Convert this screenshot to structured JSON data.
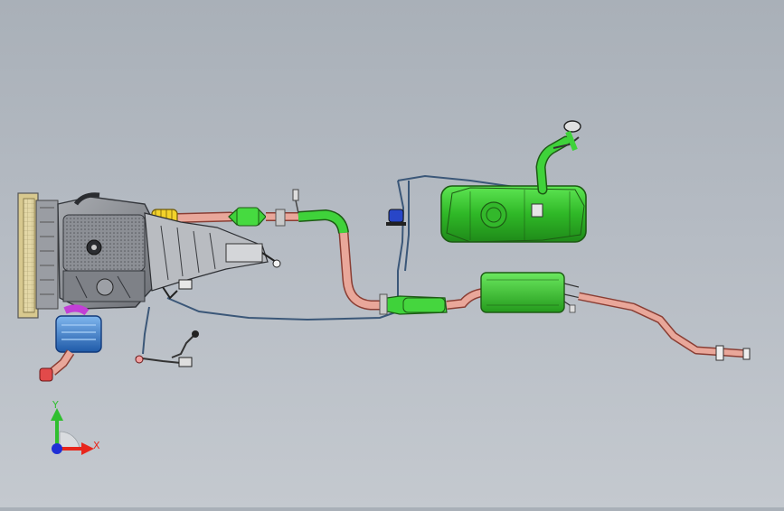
{
  "viewport": {
    "background_top": "#a9b0b8",
    "background_bottom": "#c4c9cf"
  },
  "triad": {
    "x_label": "X",
    "y_label": "Y",
    "x_color": "#e8261c",
    "y_color": "#2fbf2f",
    "z_color": "#1f2fd6"
  },
  "colors": {
    "exhaust_pipe": "#e9a79a",
    "exhaust_outline": "#8a3e34",
    "green_part": "#3fd23a",
    "green_outline": "#1d5a14",
    "fuel_tank": "#39c730",
    "muffler": "#3fcf38",
    "engine_grey": "#8f9298",
    "radiator": "#e3d7a6",
    "air_box": "#3a7fd0",
    "intake_magenta": "#c23fd6",
    "wiring": "#3b5778"
  },
  "components": [
    {
      "name": "radiator",
      "icon": "radiator-icon"
    },
    {
      "name": "engine-block",
      "icon": "engine-icon"
    },
    {
      "name": "transmission",
      "icon": "gearbox-icon"
    },
    {
      "name": "air-filter-box",
      "icon": "air-filter-icon"
    },
    {
      "name": "catalytic-converter",
      "icon": "catalyst-icon"
    },
    {
      "name": "resonator",
      "icon": "resonator-icon"
    },
    {
      "name": "fuel-tank",
      "icon": "fuel-tank-icon"
    },
    {
      "name": "rear-muffler",
      "icon": "muffler-icon"
    },
    {
      "name": "tail-pipe",
      "icon": "tailpipe-icon"
    }
  ]
}
